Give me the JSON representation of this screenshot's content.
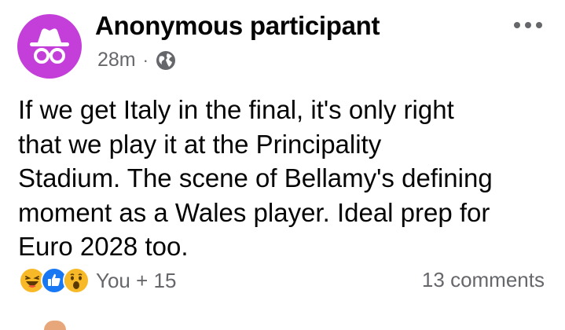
{
  "post": {
    "author": "Anonymous participant",
    "time": "28m",
    "separator": "·",
    "privacy_icon": "globe-icon",
    "avatar_icon": "incognito-icon",
    "avatar_color": "#c43fd9",
    "more_icon": "more-horizontal-icon",
    "text": "If we get Italy in the final, it's only right\nthat we play it at the Principality\nStadium. The scene of Bellamy's defining\nmoment as a Wales player. Ideal prep for\nEuro 2028 too.",
    "reactions": {
      "icons": [
        "haha-icon",
        "like-icon",
        "wow-icon"
      ],
      "summary": "You + 15"
    },
    "comments": "13 comments"
  }
}
